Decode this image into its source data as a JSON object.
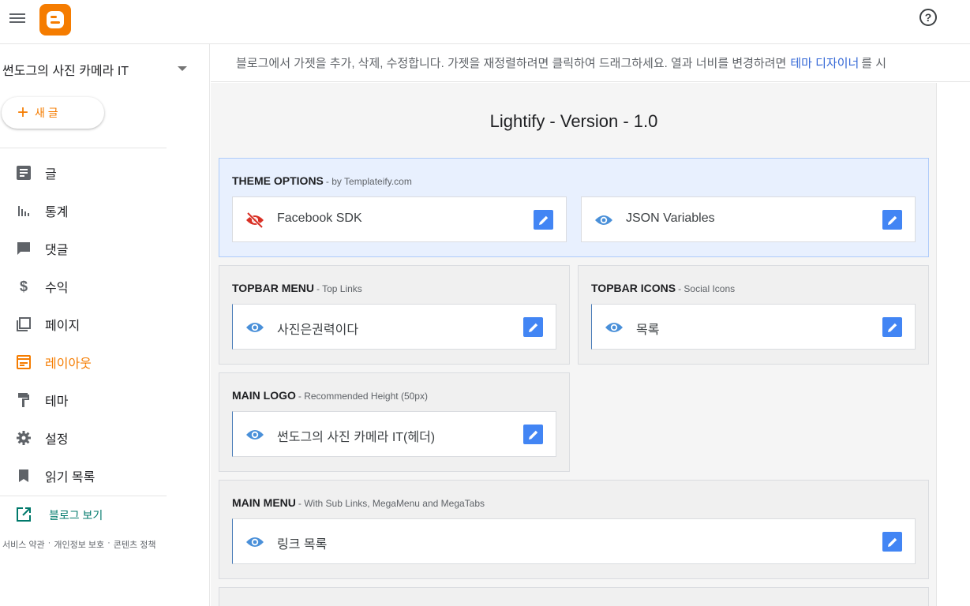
{
  "header": {
    "help_glyph": "?"
  },
  "sidebar": {
    "blog_name": "썬도그의 사진 카메라 IT",
    "new_post_label": "새 글",
    "items": [
      {
        "label": "글",
        "icon": "posts-icon"
      },
      {
        "label": "통계",
        "icon": "stats-icon"
      },
      {
        "label": "댓글",
        "icon": "comments-icon"
      },
      {
        "label": "수익",
        "icon": "earnings-icon"
      },
      {
        "label": "페이지",
        "icon": "pages-icon"
      },
      {
        "label": "레이아웃",
        "icon": "layout-icon"
      },
      {
        "label": "테마",
        "icon": "theme-icon"
      },
      {
        "label": "설정",
        "icon": "settings-icon"
      },
      {
        "label": "읽기 목록",
        "icon": "reading-list-icon"
      }
    ],
    "view_blog_label": "블로그 보기",
    "footer": [
      "서비스 약관",
      "개인정보 보호",
      "콘텐츠 정책"
    ]
  },
  "main": {
    "info_text": "블로그에서 가젯을 추가, 삭제, 수정합니다. 가젯을 재정렬하려면 클릭하여 드래그하세요. 열과 너비를 변경하려면",
    "info_link": "테마 디자이너",
    "info_tail": "를 시",
    "layout_title": "Lightify - Version - 1.0",
    "sections": {
      "theme_options": {
        "title": "THEME OPTIONS",
        "subtitle": "- by Templateify.com",
        "gadgets": [
          {
            "label": "Facebook SDK",
            "icon": "eye-off-icon"
          },
          {
            "label": "JSON Variables",
            "icon": "eye-icon"
          }
        ]
      },
      "topbar_menu": {
        "title": "TOPBAR MENU",
        "subtitle": "- Top Links",
        "gadgets": [
          {
            "label": "사진은권력이다",
            "icon": "eye-icon"
          }
        ]
      },
      "topbar_icons": {
        "title": "TOPBAR ICONS",
        "subtitle": "- Social Icons",
        "gadgets": [
          {
            "label": "목록",
            "icon": "eye-icon"
          }
        ]
      },
      "main_logo": {
        "title": "MAIN LOGO",
        "subtitle": "- Recommended Height (50px)",
        "gadgets": [
          {
            "label": "썬도그의 사진 카메라 IT(헤더)",
            "icon": "eye-icon"
          }
        ]
      },
      "main_menu": {
        "title": "MAIN MENU",
        "subtitle": "- With Sub Links, MegaMenu and MegaTabs",
        "gadgets": [
          {
            "label": "링크 목록",
            "icon": "eye-icon"
          }
        ]
      }
    }
  },
  "colors": {
    "accent": "#f57c00",
    "link": "#3367d6",
    "edit_button": "#4285f4",
    "eye": "#4a90d9",
    "eye_off": "#d93025",
    "highlight_bg": "#e8f0fe"
  }
}
